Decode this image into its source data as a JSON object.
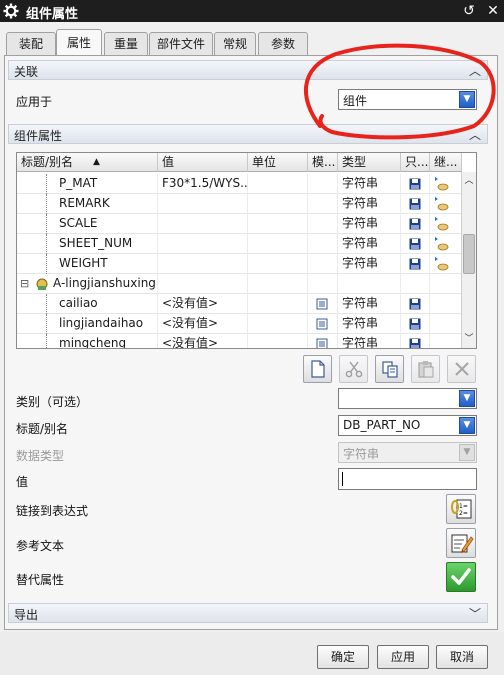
{
  "window": {
    "title": "组件属性"
  },
  "tabs": [
    "装配",
    "属性",
    "重量",
    "部件文件",
    "常规",
    "参数"
  ],
  "sections": {
    "association": "关联",
    "component_attributes": "组件属性",
    "export": "导出"
  },
  "apply_to": {
    "label": "应用于",
    "value": "组件"
  },
  "grid": {
    "headers": [
      "标题/别名",
      "值",
      "单位",
      "模...",
      "类型",
      "只...",
      "继..."
    ],
    "rows": [
      {
        "title": "P_MAT",
        "value": "F30*1.5/WYS...",
        "unit": "",
        "type": "字符串"
      },
      {
        "title": "REMARK",
        "value": "",
        "unit": "",
        "type": "字符串"
      },
      {
        "title": "SCALE",
        "value": "",
        "unit": "",
        "type": "字符串"
      },
      {
        "title": "SHEET_NUM",
        "value": "",
        "unit": "",
        "type": "字符串"
      },
      {
        "title": "WEIGHT",
        "value": "",
        "unit": "",
        "type": "字符串"
      },
      {
        "title": "A-lingjianshuxing",
        "value": "",
        "unit": "",
        "type": ""
      },
      {
        "title": "cailiao",
        "value": "<没有值>",
        "unit": "",
        "type": "字符串"
      },
      {
        "title": "lingjiandaihao",
        "value": "<没有值>",
        "unit": "",
        "type": "字符串"
      },
      {
        "title": "mingcheng",
        "value": "<没有值>",
        "unit": "",
        "type": "字符串"
      }
    ]
  },
  "form": {
    "category_label": "类别（可选）",
    "category_value": "",
    "title_alias_label": "标题/别名",
    "title_alias_value": "DB_PART_NO",
    "data_type_label": "数据类型",
    "data_type_value": "字符串",
    "value_label": "值",
    "value_value": "",
    "link_expr_label": "链接到表达式",
    "ref_text_label": "参考文本",
    "alt_attr_label": "替代属性"
  },
  "buttons": {
    "ok": "确定",
    "apply": "应用",
    "cancel": "取消"
  },
  "colors": {
    "titlebar": "#1e1e1e",
    "annotation": "#e8231c",
    "accent": "#1f5fc8"
  }
}
